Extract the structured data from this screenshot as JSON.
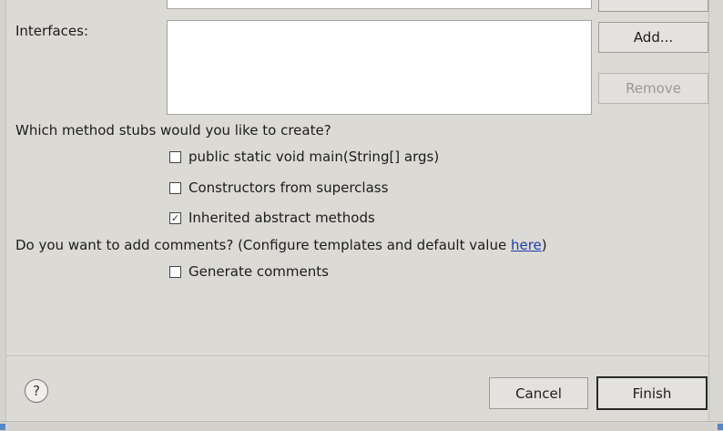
{
  "interfaces": {
    "label": "Interfaces:",
    "add_button": "Add...",
    "remove_button": "Remove"
  },
  "method_stubs": {
    "question": "Which method stubs would you like to create?",
    "options": [
      {
        "label": "public static void main(String[] args)",
        "checked": false
      },
      {
        "label": "Constructors from superclass",
        "checked": false
      },
      {
        "label": "Inherited abstract methods",
        "checked": true
      }
    ]
  },
  "comments": {
    "question_prefix": "Do you want to add comments? (Configure templates and default value ",
    "link_text": "here",
    "question_suffix": ")",
    "option": {
      "label": "Generate comments",
      "checked": false
    }
  },
  "footer": {
    "help_icon_text": "?",
    "cancel_button": "Cancel",
    "finish_button": "Finish"
  },
  "icons": {
    "help": "help-icon",
    "checkbox": "checkbox-icon"
  },
  "colors": {
    "background": "#dcdad5",
    "link": "#1a3fb0"
  }
}
